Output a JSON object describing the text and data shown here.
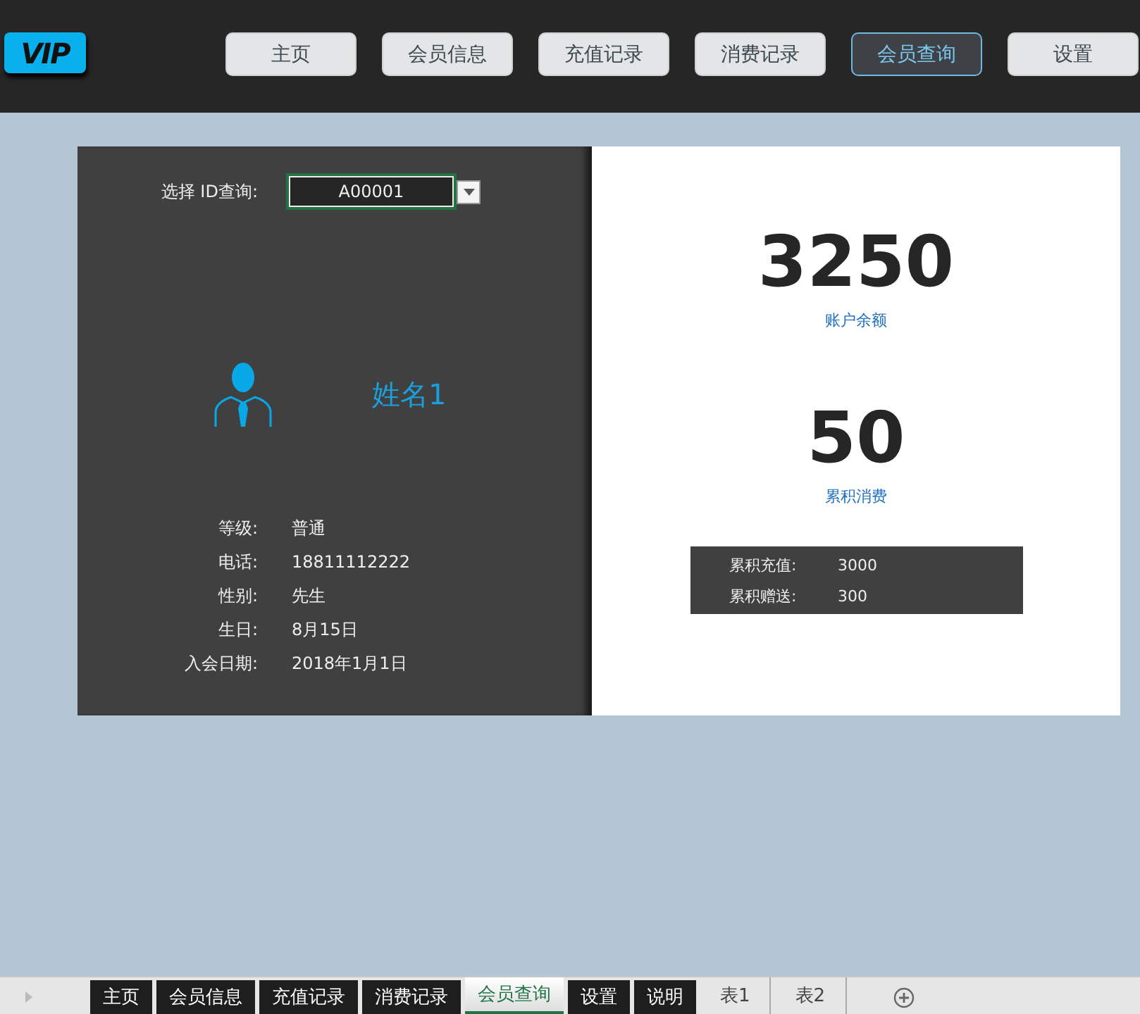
{
  "logo": "VIP",
  "nav": [
    {
      "label": "主页",
      "selected": false
    },
    {
      "label": "会员信息",
      "selected": false
    },
    {
      "label": "充值记录",
      "selected": false
    },
    {
      "label": "消费记录",
      "selected": false
    },
    {
      "label": "会员查询",
      "selected": true
    },
    {
      "label": "设置",
      "selected": false
    }
  ],
  "query": {
    "label": "选择 ID查询:",
    "value": "A00001"
  },
  "member": {
    "name": "姓名1",
    "fields": [
      {
        "label": "等级:",
        "value": "普通"
      },
      {
        "label": "电话:",
        "value": "18811112222"
      },
      {
        "label": "性别:",
        "value": "先生"
      },
      {
        "label": "生日:",
        "value": "8月15日"
      },
      {
        "label": "入会日期:",
        "value": "2018年1月1日"
      }
    ]
  },
  "stats": [
    {
      "value": "3250",
      "label": "账户余额"
    },
    {
      "value": "50",
      "label": "累积消费"
    }
  ],
  "totals": [
    {
      "label": "累积充值:",
      "value": "3000"
    },
    {
      "label": "累积赠送:",
      "value": "300"
    }
  ],
  "sheet_tabs": [
    {
      "label": "主页",
      "kind": "dark",
      "selected": false
    },
    {
      "label": "会员信息",
      "kind": "dark",
      "selected": false
    },
    {
      "label": "充值记录",
      "kind": "dark",
      "selected": false
    },
    {
      "label": "消费记录",
      "kind": "dark",
      "selected": false
    },
    {
      "label": "会员查询",
      "kind": "dark",
      "selected": true
    },
    {
      "label": "设置",
      "kind": "dark",
      "selected": false
    },
    {
      "label": "说明",
      "kind": "dark",
      "selected": false
    },
    {
      "label": "表1",
      "kind": "plain",
      "selected": false
    },
    {
      "label": "表2",
      "kind": "plain",
      "selected": false
    }
  ]
}
